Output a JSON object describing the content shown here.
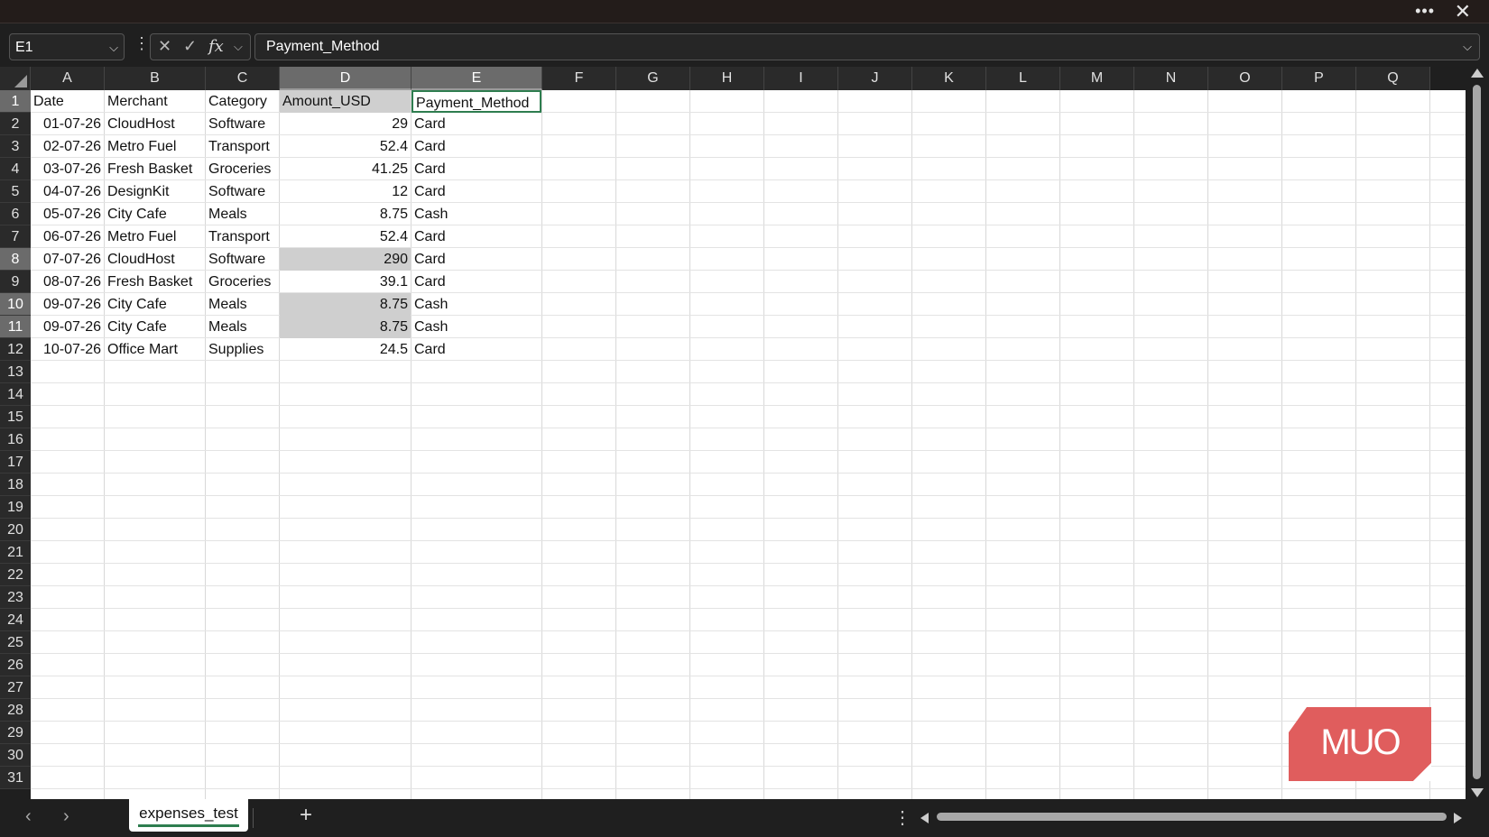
{
  "window": {
    "more_icon": "ellipsis-icon",
    "close_icon": "close-icon"
  },
  "formula_bar": {
    "name_box": "E1",
    "formula": "Payment_Method"
  },
  "columns": [
    "A",
    "B",
    "C",
    "D",
    "E",
    "F",
    "G",
    "H",
    "I",
    "J",
    "K",
    "L",
    "M",
    "N",
    "O",
    "P",
    "Q"
  ],
  "rows": [
    "1",
    "2",
    "3",
    "4",
    "5",
    "6",
    "7",
    "8",
    "9",
    "10",
    "11",
    "12",
    "13",
    "14",
    "15",
    "16",
    "17",
    "18",
    "19",
    "20",
    "21",
    "22",
    "23",
    "24",
    "25",
    "26",
    "27",
    "28",
    "29",
    "30",
    "31"
  ],
  "headers": [
    "Date",
    "Merchant",
    "Category",
    "Amount_USD",
    "Payment_Method"
  ],
  "data": [
    [
      "01-07-26",
      "CloudHost",
      "Software",
      "29",
      "Card"
    ],
    [
      "02-07-26",
      "Metro Fuel",
      "Transport",
      "52.4",
      "Card"
    ],
    [
      "03-07-26",
      "Fresh Basket",
      "Groceries",
      "41.25",
      "Card"
    ],
    [
      "04-07-26",
      "DesignKit",
      "Software",
      "12",
      "Card"
    ],
    [
      "05-07-26",
      "City Cafe",
      "Meals",
      "8.75",
      "Cash"
    ],
    [
      "06-07-26",
      "Metro Fuel",
      "Transport",
      "52.4",
      "Card"
    ],
    [
      "07-07-26",
      "CloudHost",
      "Software",
      "290",
      "Card"
    ],
    [
      "08-07-26",
      "Fresh Basket",
      "Groceries",
      "39.1",
      "Card"
    ],
    [
      "09-07-26",
      "City Cafe",
      "Meals",
      "8.75",
      "Cash"
    ],
    [
      "09-07-26",
      "City Cafe",
      "Meals",
      "8.75",
      "Cash"
    ],
    [
      "10-07-26",
      "Office Mart",
      "Supplies",
      "24.5",
      "Card"
    ]
  ],
  "sheet_tab": "expenses_test",
  "watermark": "MUO"
}
